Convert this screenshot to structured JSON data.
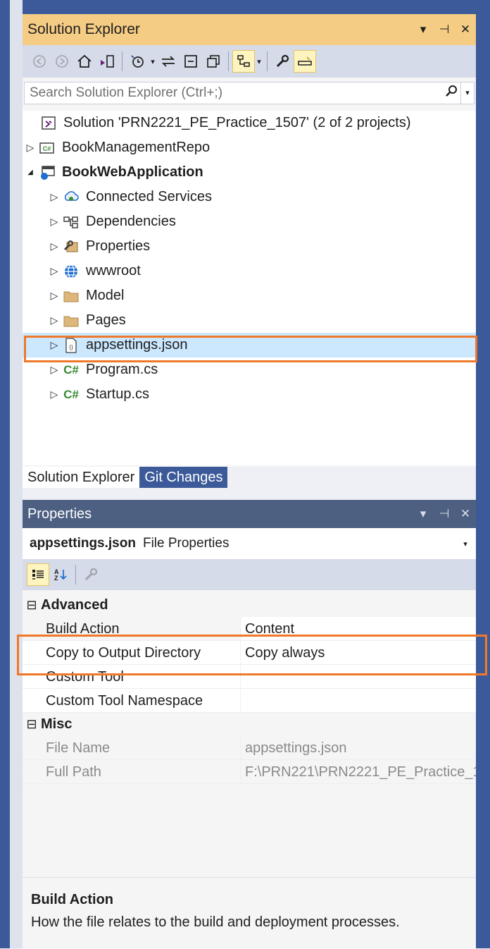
{
  "solution_explorer": {
    "title": "Solution Explorer",
    "title_buttons": [
      "▾",
      "⊣",
      "✕"
    ],
    "search_placeholder": "Search Solution Explorer (Ctrl+;)",
    "tree": [
      {
        "label": "Solution 'PRN2221_PE_Practice_1507' (2 of 2 projects)",
        "icon": "solution-icon",
        "expander": ""
      },
      {
        "label": "BookManagementRepo",
        "icon": "csharp-project-icon",
        "expander": "▷"
      },
      {
        "label": "BookWebApplication",
        "icon": "web-project-icon",
        "expander": "◢"
      },
      {
        "label": "Connected Services",
        "icon": "connected-services-icon",
        "expander": "▷"
      },
      {
        "label": "Dependencies",
        "icon": "dependencies-icon",
        "expander": "▷"
      },
      {
        "label": "Properties",
        "icon": "properties-wrench-icon",
        "expander": "▷"
      },
      {
        "label": "wwwroot",
        "icon": "globe-icon",
        "expander": "▷"
      },
      {
        "label": "Model",
        "icon": "folder-icon",
        "expander": "▷"
      },
      {
        "label": "Pages",
        "icon": "folder-icon",
        "expander": "▷"
      },
      {
        "label": "appsettings.json",
        "icon": "json-file-icon",
        "expander": "▷"
      },
      {
        "label": "Program.cs",
        "icon": "csharp-file-icon",
        "expander": "▷"
      },
      {
        "label": "Startup.cs",
        "icon": "csharp-file-icon",
        "expander": "▷"
      }
    ],
    "tabs": [
      "Solution Explorer",
      "Git Changes"
    ]
  },
  "properties": {
    "title": "Properties",
    "title_buttons": [
      "▾",
      "⊣",
      "✕"
    ],
    "object_name": "appsettings.json",
    "object_type": "File Properties",
    "categories": {
      "advanced": "Advanced",
      "misc": "Misc"
    },
    "advanced_rows": [
      {
        "name": "Build Action",
        "value": "Content"
      },
      {
        "name": "Copy to Output Directory",
        "value": "Copy always"
      },
      {
        "name": "Custom Tool",
        "value": ""
      },
      {
        "name": "Custom Tool Namespace",
        "value": ""
      }
    ],
    "misc_rows": [
      {
        "name": "File Name",
        "value": "appsettings.json"
      },
      {
        "name": "Full Path",
        "value": "F:\\PRN221\\PRN2221_PE_Practice_1"
      }
    ],
    "description": {
      "title": "Build Action",
      "text": "How the file relates to the build and deployment processes."
    }
  },
  "colors": {
    "accent_title": "#f5cc84",
    "highlight": "#f0782a",
    "selection": "#cce8ff",
    "properties_title": "#4d6082"
  }
}
